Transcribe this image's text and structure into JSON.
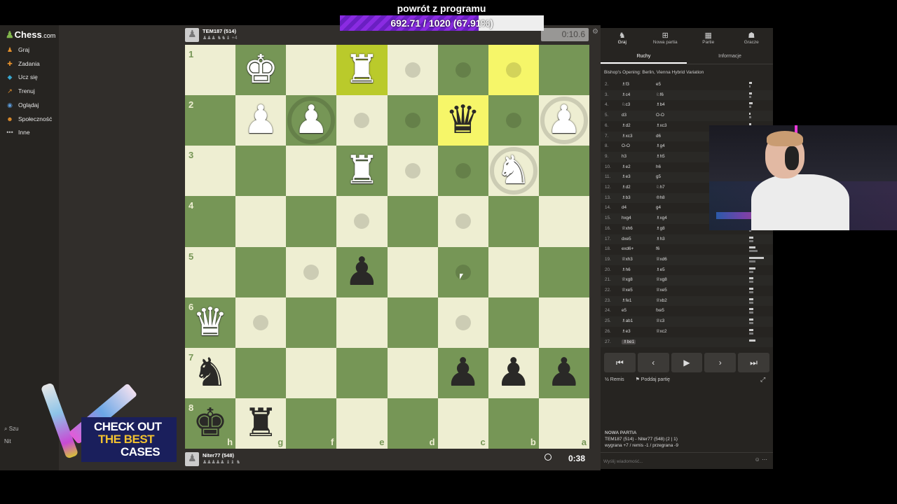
{
  "stream": {
    "title": "powrót z programu",
    "goal_text": "692.71 / 1020 (67.91%)",
    "goal_fraction": 0.6791
  },
  "sidebar": {
    "logo_main": "Chess",
    "logo_suffix": ".com",
    "items": [
      {
        "label": "Graj",
        "icon": "play-icon",
        "color": "#e6912c"
      },
      {
        "label": "Zadania",
        "icon": "puzzle-icon",
        "color": "#e6912c"
      },
      {
        "label": "Ucz się",
        "icon": "learn-icon",
        "color": "#38a6ce"
      },
      {
        "label": "Trenuj",
        "icon": "train-icon",
        "color": "#e6912c"
      },
      {
        "label": "Oglądaj",
        "icon": "watch-icon",
        "color": "#5b9ad8"
      },
      {
        "label": "Społeczność",
        "icon": "community-icon",
        "color": "#e6912c"
      },
      {
        "label": "Inne",
        "icon": "more-icon",
        "color": "#bbbbbb"
      }
    ],
    "footer_search": "Szu",
    "footer_user": "Nit"
  },
  "players": {
    "top": {
      "name": "TEM187 (514)",
      "captured": "♟♟♟ ♞♞♝ +4",
      "clock": "0:10.6"
    },
    "bottom": {
      "name": "Niter77 (548)",
      "captured": "♟♟♟♟♟ ♝♝ ♞",
      "clock": "0:38"
    }
  },
  "board": {
    "ranks": [
      "1",
      "2",
      "3",
      "4",
      "5",
      "6",
      "7",
      "8"
    ],
    "files": [
      "h",
      "g",
      "f",
      "e",
      "d",
      "c",
      "b",
      "a"
    ],
    "pieces": [
      {
        "sq": "g1",
        "glyph": "♚",
        "color": "w"
      },
      {
        "sq": "e1",
        "glyph": "♜",
        "color": "w"
      },
      {
        "sq": "g2",
        "glyph": "♟",
        "color": "w"
      },
      {
        "sq": "f2",
        "glyph": "♟",
        "color": "w"
      },
      {
        "sq": "a2",
        "glyph": "♟",
        "color": "w"
      },
      {
        "sq": "c2",
        "glyph": "♛",
        "color": "b"
      },
      {
        "sq": "e3",
        "glyph": "♜",
        "color": "w"
      },
      {
        "sq": "b3",
        "glyph": "♞",
        "color": "w"
      },
      {
        "sq": "e5",
        "glyph": "♟",
        "color": "b"
      },
      {
        "sq": "h6",
        "glyph": "♛",
        "color": "w"
      },
      {
        "sq": "h7",
        "glyph": "♞",
        "color": "b"
      },
      {
        "sq": "c7",
        "glyph": "♟",
        "color": "b"
      },
      {
        "sq": "b7",
        "glyph": "♟",
        "color": "b"
      },
      {
        "sq": "a7",
        "glyph": "♟",
        "color": "b"
      },
      {
        "sq": "h8",
        "glyph": "♚",
        "color": "b"
      },
      {
        "sq": "g8",
        "glyph": "♜",
        "color": "b"
      }
    ],
    "highlights": [
      "e1",
      "b1",
      "c2"
    ],
    "dots": [
      "d1",
      "c1",
      "b1",
      "e2",
      "d2",
      "b2",
      "d3",
      "c3",
      "e4",
      "c4",
      "f5",
      "c5",
      "g6",
      "c6"
    ],
    "rings": [
      "f2",
      "a2",
      "b3"
    ]
  },
  "right_panel": {
    "tabs": [
      {
        "label": "Graj",
        "icon": "pawn-icon"
      },
      {
        "label": "Nowa partia",
        "icon": "plus-icon"
      },
      {
        "label": "Partie",
        "icon": "board-icon"
      },
      {
        "label": "Gracze",
        "icon": "players-icon"
      }
    ],
    "subtabs": [
      "Ruchy",
      "Informacje"
    ],
    "opening": "Bishop's Opening: Berlin, Vienna Hybrid Variation",
    "moves": [
      {
        "n": "2.",
        "w": "♗f3",
        "b": "e5",
        "t1": 0.12,
        "t2": 0.08
      },
      {
        "n": "3.",
        "w": "♗c4",
        "b": "♘f6",
        "t1": 0.14,
        "t2": 0.1
      },
      {
        "n": "4.",
        "w": "♘c3",
        "b": "♗b4",
        "t1": 0.16,
        "t2": 0.1
      },
      {
        "n": "5.",
        "w": "d3",
        "b": "O-O",
        "t1": 0.08,
        "t2": 0.1
      },
      {
        "n": "6.",
        "w": "♗d2",
        "b": "♗xc3",
        "t1": 0.1,
        "t2": 0.2
      },
      {
        "n": "7.",
        "w": "♗xc3",
        "b": "d6",
        "t1": 0.1,
        "t2": 0.1
      },
      {
        "n": "8.",
        "w": "O-O",
        "b": "♗g4",
        "t1": 0.1,
        "t2": 0.1
      },
      {
        "n": "9.",
        "w": "h3",
        "b": "♗h5",
        "t1": 0.1,
        "t2": 0.1
      },
      {
        "n": "10.",
        "w": "♗e2",
        "b": "h6",
        "t1": 0.1,
        "t2": 0.1
      },
      {
        "n": "11.",
        "w": "♗e3",
        "b": "g5",
        "t1": 0.1,
        "t2": 0.1
      },
      {
        "n": "12.",
        "w": "♗d2",
        "b": "♘h7",
        "t1": 0.1,
        "t2": 0.1
      },
      {
        "n": "13.",
        "w": "♗b3",
        "b": "♔h8",
        "t1": 0.1,
        "t2": 0.1
      },
      {
        "n": "14.",
        "w": "d4",
        "b": "g4",
        "t1": 0.1,
        "t2": 0.1
      },
      {
        "n": "15.",
        "w": "hxg4",
        "b": "♗xg4",
        "t1": 0.3,
        "t2": 0.1
      },
      {
        "n": "16.",
        "w": "♕xh6",
        "b": "♗g8",
        "t1": 0.2,
        "t2": 0.1
      },
      {
        "n": "17.",
        "w": "dxe5",
        "b": "♗h3",
        "t1": 0.2,
        "t2": 0.2
      },
      {
        "n": "18.",
        "w": "exd6+",
        "b": "f6",
        "t1": 0.3,
        "t2": 0.4
      },
      {
        "n": "19.",
        "w": "♕xh3",
        "b": "♕xd6",
        "t1": 0.7,
        "t2": 0.3
      },
      {
        "n": "20.",
        "w": "♗h6",
        "b": "♗e5",
        "t1": 0.3,
        "t2": 0.2
      },
      {
        "n": "21.",
        "w": "♕xg8",
        "b": "♕xg8",
        "t1": 0.2,
        "t2": 0.2
      },
      {
        "n": "22.",
        "w": "♕xe5",
        "b": "♕xe5",
        "t1": 0.2,
        "t2": 0.2
      },
      {
        "n": "23.",
        "w": "♗fe1",
        "b": "♕xb2",
        "t1": 0.2,
        "t2": 0.2
      },
      {
        "n": "24.",
        "w": "e5",
        "b": "fxe5",
        "t1": 0.2,
        "t2": 0.2
      },
      {
        "n": "25.",
        "w": "♗ab1",
        "b": "♕c3",
        "t1": 0.2,
        "t2": 0.2
      },
      {
        "n": "26.",
        "w": "♗e3",
        "b": "♕xc2",
        "t1": 0.2,
        "t2": 0.2
      },
      {
        "n": "27.",
        "w": "♗be1",
        "b": "",
        "t1": 0.3,
        "t2": 0
      }
    ],
    "nav": [
      "⏮",
      "‹",
      "▶",
      "›",
      "⏭"
    ],
    "actions": {
      "draw": "½ Remis",
      "resign": "⚑ Poddaj partię"
    },
    "game_info": {
      "header": "NOWA PARTIA",
      "matchup": "TEM187 (514) - Niter77 (548) (2 | 1)",
      "result": "wygrana +7 / remis -1 / przegrana -9"
    },
    "chat_placeholder": "Wyślij wiadomość..."
  },
  "ad": {
    "line1": "CHECK OUT",
    "line2": "THE BEST",
    "line3": "CASES"
  }
}
